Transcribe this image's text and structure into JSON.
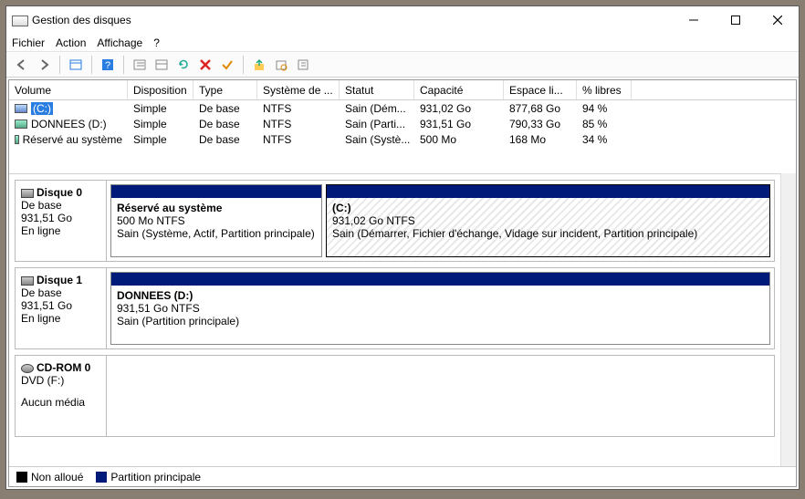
{
  "window": {
    "title": "Gestion des disques"
  },
  "menus": {
    "fichier": "Fichier",
    "action": "Action",
    "affichage": "Affichage",
    "help": "?"
  },
  "columns": {
    "volume": "Volume",
    "disposition": "Disposition",
    "type": "Type",
    "fs": "Système de ...",
    "statut": "Statut",
    "capacite": "Capacité",
    "espace": "Espace li...",
    "pct": "% libres"
  },
  "volumes": [
    {
      "name": "(C:)",
      "disposition": "Simple",
      "type": "De base",
      "fs": "NTFS",
      "statut": "Sain (Dém...",
      "cap": "931,02 Go",
      "free": "877,68 Go",
      "pct": "94 %",
      "selected": true
    },
    {
      "name": "DONNEES (D:)",
      "disposition": "Simple",
      "type": "De base",
      "fs": "NTFS",
      "statut": "Sain (Parti...",
      "cap": "931,51 Go",
      "free": "790,33 Go",
      "pct": "85 %",
      "selected": false
    },
    {
      "name": "Réservé au système",
      "disposition": "Simple",
      "type": "De base",
      "fs": "NTFS",
      "statut": "Sain (Systè...",
      "cap": "500 Mo",
      "free": "168 Mo",
      "pct": "34 %",
      "selected": false
    }
  ],
  "disks": [
    {
      "title": "Disque 0",
      "type": "De base",
      "size": "931,51 Go",
      "status": "En ligne",
      "partitions": [
        {
          "name": "Réservé au système",
          "size": "500 Mo NTFS",
          "status": "Sain (Système, Actif, Partition principale)",
          "selected": false,
          "narrow": true
        },
        {
          "name": "(C:)",
          "size": "931,02 Go NTFS",
          "status": "Sain (Démarrer, Fichier d'échange, Vidage sur incident, Partition principale)",
          "selected": true,
          "narrow": false
        }
      ]
    },
    {
      "title": "Disque 1",
      "type": "De base",
      "size": "931,51 Go",
      "status": "En ligne",
      "partitions": [
        {
          "name": "DONNEES  (D:)",
          "size": "931,51 Go NTFS",
          "status": "Sain (Partition principale)",
          "selected": false,
          "narrow": false
        }
      ]
    },
    {
      "title": "CD-ROM 0",
      "type": "DVD (F:)",
      "size": "",
      "status": "Aucun média",
      "partitions": []
    }
  ],
  "legend": {
    "nonalloue": "Non alloué",
    "principale": "Partition principale"
  }
}
